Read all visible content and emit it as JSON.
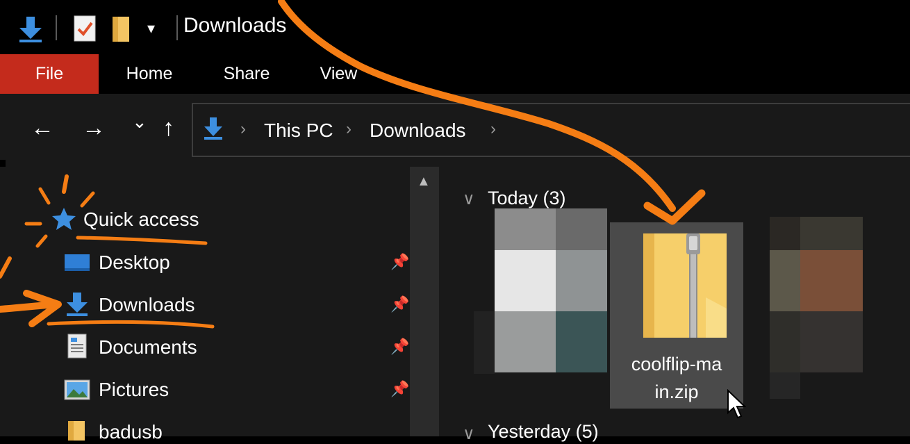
{
  "window": {
    "title": "Downloads",
    "quick_access_toolbar": {
      "icons": [
        "downloads-arrow-icon",
        "properties-check-icon",
        "new-folder-icon",
        "customize-dropdown-icon"
      ],
      "dropdown_glyph": "▾"
    }
  },
  "ribbon": {
    "tabs": [
      {
        "label": "File",
        "active": true
      },
      {
        "label": "Home"
      },
      {
        "label": "Share"
      },
      {
        "label": "View"
      }
    ]
  },
  "navigation": {
    "back_glyph": "←",
    "forward_glyph": "→",
    "recent_glyph": "⌄",
    "up_glyph": "↑"
  },
  "address_bar": {
    "breadcrumbs": [
      "This PC",
      "Downloads"
    ],
    "separator": "›"
  },
  "sidebar": {
    "quick_access_label": "Quick access",
    "items": [
      {
        "label": "Desktop",
        "icon": "desktop-icon",
        "pinned": true
      },
      {
        "label": "Downloads",
        "icon": "downloads-icon",
        "pinned": true
      },
      {
        "label": "Documents",
        "icon": "documents-icon",
        "pinned": true
      },
      {
        "label": "Pictures",
        "icon": "pictures-icon",
        "pinned": true
      },
      {
        "label": "badusb",
        "icon": "folder-icon",
        "pinned": false
      }
    ]
  },
  "content": {
    "groups": [
      {
        "label": "Today (3)",
        "collapse_glyph": "∨"
      },
      {
        "label": "Yesterday (5)",
        "collapse_glyph": "∨"
      }
    ],
    "selected_file": {
      "name_line1": "coolflip-ma",
      "name_line2": "in.zip",
      "icon": "zip-folder-icon"
    }
  },
  "colors": {
    "accent_file_tab": "#c42b1c",
    "annotation": "#f57d14",
    "background": "#191919",
    "titlebar": "#000000",
    "selected_tile": "#4a4a4a",
    "download_blue": "#3d8fe0"
  }
}
